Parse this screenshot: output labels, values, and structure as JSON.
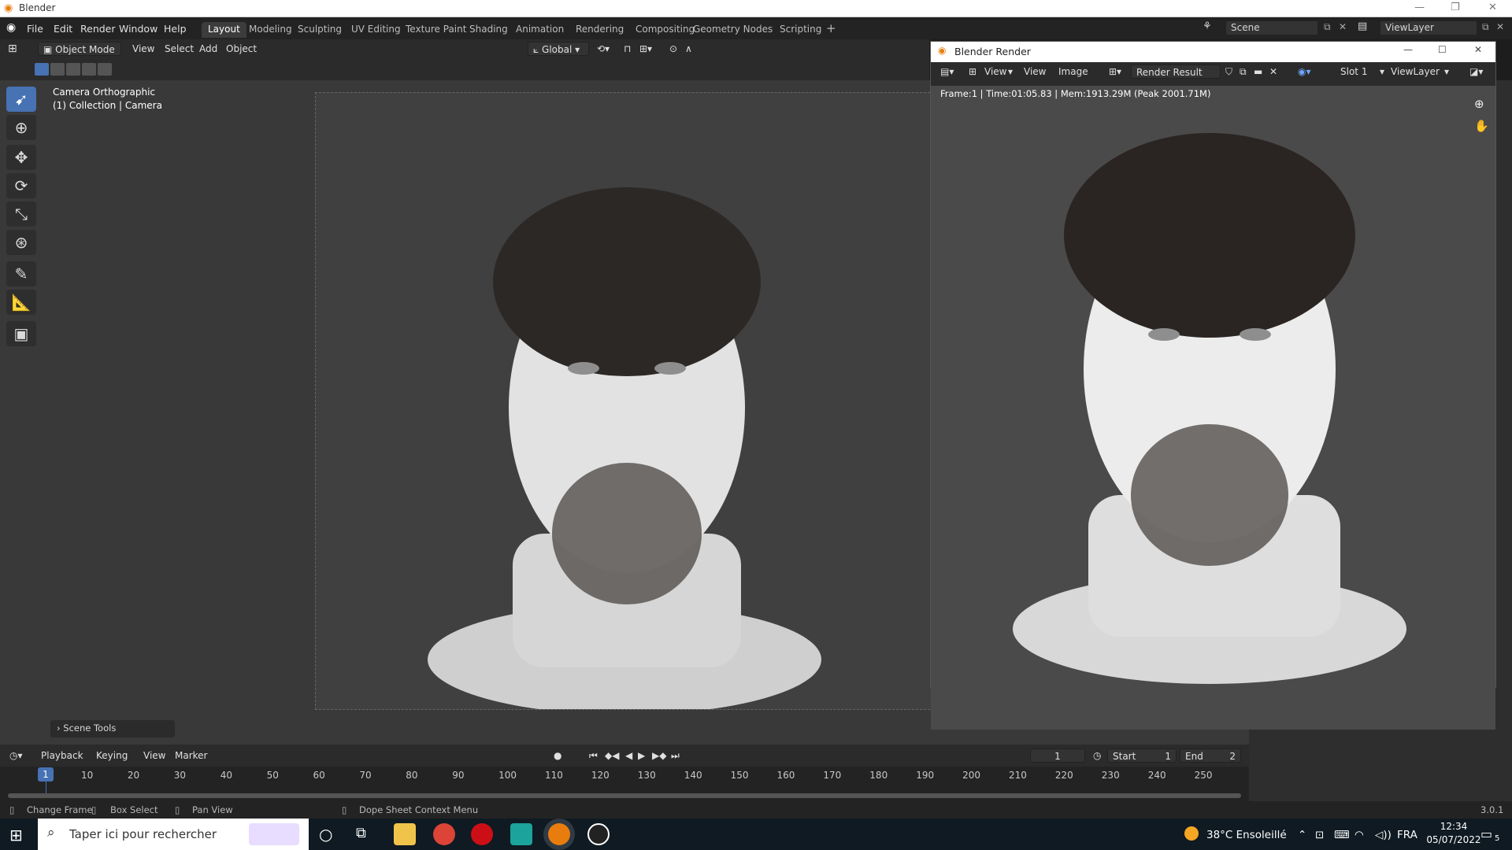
{
  "window": {
    "title": "Blender"
  },
  "menu": {
    "file": "File",
    "edit": "Edit",
    "render": "Render",
    "window": "Window",
    "help": "Help"
  },
  "workspaces": [
    "Layout",
    "Modeling",
    "Sculpting",
    "UV Editing",
    "Texture Paint",
    "Shading",
    "Animation",
    "Rendering",
    "Compositing",
    "Geometry Nodes",
    "Scripting"
  ],
  "scene": {
    "label": "Scene",
    "viewlayer": "ViewLayer"
  },
  "viewport_header": {
    "mode": "Object Mode",
    "view": "View",
    "select": "Select",
    "add": "Add",
    "object": "Object",
    "orientation": "Global"
  },
  "viewport_info": {
    "line1": "Camera Orthographic",
    "line2": "(1) Collection | Camera",
    "scene_tools": "Scene Tools"
  },
  "render_window": {
    "title": "Blender Render",
    "view1": "View",
    "view2": "View",
    "image": "Image",
    "result": "Render Result",
    "slot": "Slot 1",
    "viewlayer": "ViewLayer",
    "stats": "Frame:1 | Time:01:05.83 | Mem:1913.29M (Peak 2001.71M)"
  },
  "timeline": {
    "playback": "Playback",
    "keying": "Keying",
    "view": "View",
    "marker": "Marker",
    "current_frame": "1",
    "start_label": "Start",
    "start": "1",
    "end_label": "End",
    "end": "2",
    "ticks": [
      "10",
      "20",
      "30",
      "40",
      "50",
      "60",
      "70",
      "80",
      "90",
      "100",
      "110",
      "120",
      "130",
      "140",
      "150",
      "160",
      "170",
      "180",
      "190",
      "200",
      "210",
      "220",
      "230",
      "240",
      "250"
    ],
    "cursor": "1"
  },
  "statusbar": {
    "change_frame": "Change Frame",
    "box_select": "Box Select",
    "pan_view": "Pan View",
    "context_menu": "Dope Sheet Context Menu",
    "version": "3.0.1"
  },
  "taskbar": {
    "search_placeholder": "Taper ici pour rechercher",
    "weather": "38°C  Ensoleillé",
    "lang": "FRA",
    "time": "12:34",
    "date": "05/07/2022",
    "notifications": "5"
  },
  "colors": {
    "accent": "#4772b3",
    "bg": "#393939"
  }
}
